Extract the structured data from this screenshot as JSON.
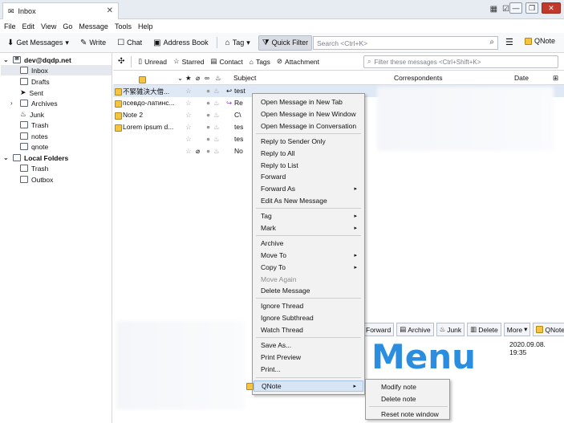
{
  "tab": {
    "title": "Inbox",
    "close": "✕"
  },
  "window_controls": {
    "minimize": "—",
    "maximize": "❐",
    "close": "✕"
  },
  "menubar": [
    "File",
    "Edit",
    "View",
    "Go",
    "Message",
    "Tools",
    "Help"
  ],
  "toolbar": {
    "get_messages": "Get Messages",
    "write": "Write",
    "chat": "Chat",
    "address_book": "Address Book",
    "tag": "Tag",
    "quick_filter": "Quick Filter",
    "search_placeholder": "Search <Ctrl+K>",
    "qnote": "QNote"
  },
  "folders": {
    "account": "dev@dqdp.net",
    "items": [
      "Inbox",
      "Drafts",
      "Sent",
      "Archives",
      "Junk",
      "Trash",
      "notes",
      "qnote"
    ],
    "local_label": "Local Folders",
    "local_items": [
      "Trash",
      "Outbox"
    ]
  },
  "filterbar": {
    "unread": "Unread",
    "starred": "Starred",
    "contact": "Contact",
    "tags": "Tags",
    "attachment": "Attachment",
    "filter_placeholder": "Filter these messages <Ctrl+Shift+K>"
  },
  "columns": {
    "subject": "Subject",
    "correspondents": "Correspondents",
    "date": "Date"
  },
  "rows": [
    {
      "note": "不緊雑決大借...",
      "subject": "test"
    },
    {
      "note": "псевдо-латинс...",
      "subject": "Re"
    },
    {
      "note": "Note 2",
      "subject": "C\\"
    },
    {
      "note": "Lorem ipsum d...",
      "subject": "tes"
    },
    {
      "note": "",
      "subject": "tes"
    },
    {
      "note": "",
      "subject": "No"
    }
  ],
  "context_menu": {
    "items": [
      "Open Message in New Tab",
      "Open Message in New Window",
      "Open Message in Conversation",
      "Reply to Sender Only",
      "Reply to All",
      "Reply to List",
      "Forward",
      "Forward As",
      "Edit As New Message",
      "Tag",
      "Mark",
      "Archive",
      "Move To",
      "Copy To",
      "Move Again",
      "Delete Message",
      "Ignore Thread",
      "Ignore Subthread",
      "Watch Thread",
      "Save As...",
      "Print Preview",
      "Print...",
      "QNote"
    ],
    "submenu_arrow": "▸"
  },
  "submenu": {
    "items": [
      "Modify note",
      "Delete note",
      "Reset note window"
    ]
  },
  "message_buttons": [
    "Forward",
    "Archive",
    "Junk",
    "Delete",
    "More",
    "QNote"
  ],
  "message_date": "2020.09.08. 19:35",
  "overlay_text": "Menu",
  "colors": {
    "overlay": "#2b8de0",
    "selection": "#dfe8f5",
    "menu_hover": "#d8e5f5"
  }
}
